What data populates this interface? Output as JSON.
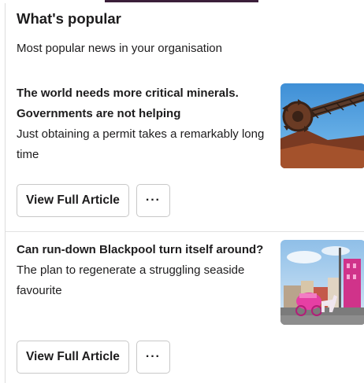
{
  "header": {
    "title": "What's popular",
    "subtitle": "Most popular news in your organisation"
  },
  "articles": [
    {
      "headline": "The world needs more critical minerals. Governments are not helping",
      "summary": "Just obtaining a permit takes a remarkably long time",
      "view_label": "View Full Article",
      "more_label": "···",
      "image_icon": "mining-excavator-image"
    },
    {
      "headline": "Can run-down Blackpool turn itself around?",
      "summary": "The plan to regenerate a struggling seaside favourite",
      "view_label": "View Full Article",
      "more_label": "···",
      "image_icon": "blackpool-seafront-image"
    }
  ],
  "colors": {
    "text": "#1d1c1d",
    "border": "#c8c8c8",
    "divider": "#e2e2e2"
  }
}
